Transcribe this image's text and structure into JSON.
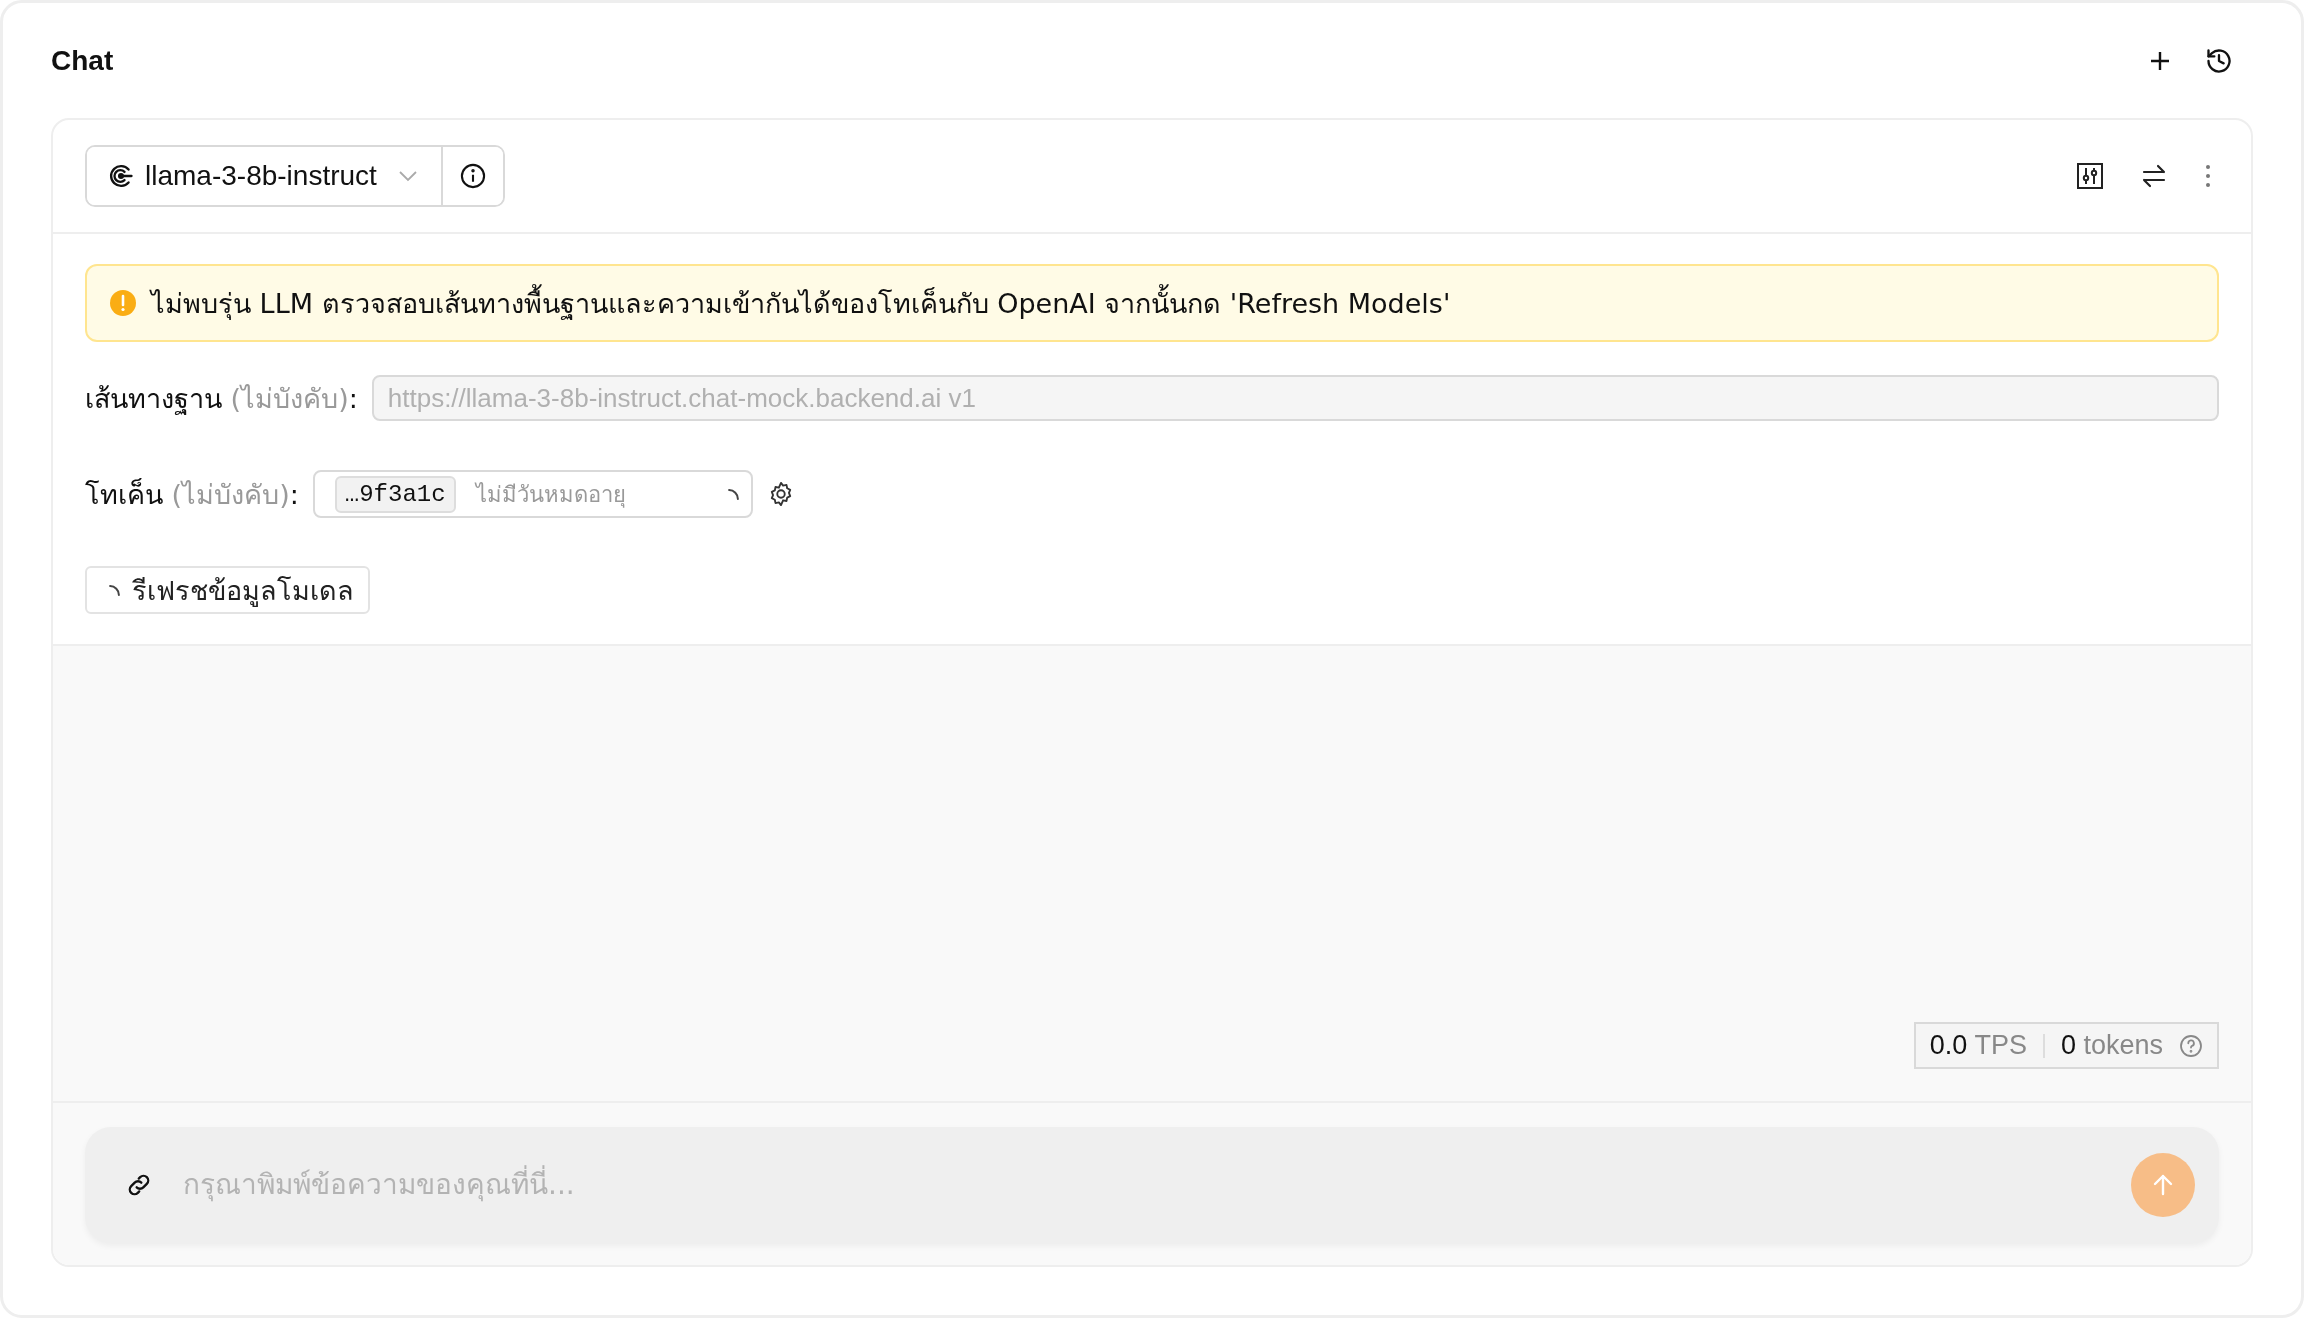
{
  "title": "Chat",
  "model_selector": {
    "value": "llama-3-8b-instruct"
  },
  "alert": {
    "message": "ไม่พบรุ่น LLM ตรวจสอบเส้นทางพื้นฐานและความเข้ากันได้ของโทเค็นกับ OpenAI จากนั้นกด 'Refresh Models'"
  },
  "base_url": {
    "label": "เส้นทางฐาน",
    "hint": "(ไม่บังคับ)",
    "suffix": ":",
    "placeholder": "https://llama-3-8b-instruct.chat-mock.backend.ai v1",
    "disabled": true
  },
  "token": {
    "label": "โทเค็น",
    "hint": "(ไม่บังคับ)",
    "suffix": ":",
    "value": "…9f3a1c",
    "expiry": "ไม่มีวันหมดอายุ",
    "loading": true
  },
  "refresh_button": {
    "label": "รีเฟรชข้อมูลโมเดล",
    "loading": true
  },
  "stats": {
    "tps": "0.0",
    "tps_unit": "TPS",
    "tokens": "0",
    "tokens_unit": "tokens"
  },
  "composer": {
    "placeholder": "กรุณาพิมพ์ข้อความของคุณที่นี่...",
    "send_disabled": true
  }
}
